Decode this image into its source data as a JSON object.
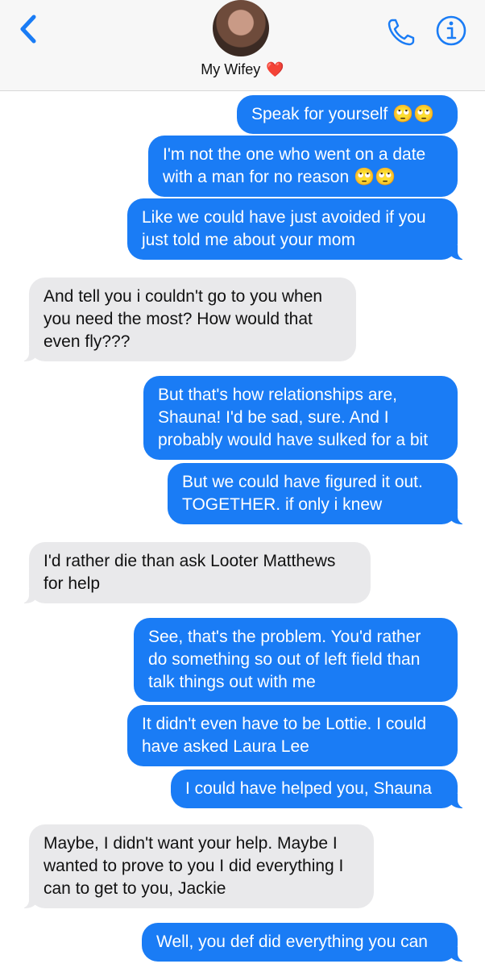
{
  "header": {
    "contact_name": "My Wifey",
    "contact_emoji": "❤️",
    "back_icon": "chevron-left-icon",
    "call_icon": "phone-icon",
    "info_icon": "info-icon"
  },
  "colors": {
    "outgoing": "#1a7cf5",
    "incoming": "#e9e9eb",
    "accent": "#1a7cf5"
  },
  "messages": [
    {
      "direction": "out",
      "text": "Speak for yourself 🙄🙄"
    },
    {
      "direction": "out",
      "text": "I'm not the one who went on a date with a man for no reason 🙄🙄"
    },
    {
      "direction": "out",
      "text": "Like we could have just avoided if you just told me about your mom"
    },
    {
      "direction": "in",
      "text": "And tell you i couldn't go to you when you need the most? How would that even fly???"
    },
    {
      "direction": "out",
      "text": "But that's how relationships are, Shauna! I'd be sad, sure. And I probably would have sulked for a bit"
    },
    {
      "direction": "out",
      "text": "But we could have figured it out. TOGETHER. if only i knew"
    },
    {
      "direction": "in",
      "text": "I'd rather die than ask Looter Matthews for help"
    },
    {
      "direction": "out",
      "text": "See, that's the problem. You'd rather do something so out of left field than talk things out with me"
    },
    {
      "direction": "out",
      "text": "It didn't even have to be Lottie. I could have asked Laura Lee"
    },
    {
      "direction": "out",
      "text": "I could have helped you, Shauna"
    },
    {
      "direction": "in",
      "text": "Maybe, I didn't want your help. Maybe I wanted to prove to you I did everything I can to get to you, Jackie"
    },
    {
      "direction": "out",
      "text": "Well, you def did everything you can"
    }
  ]
}
